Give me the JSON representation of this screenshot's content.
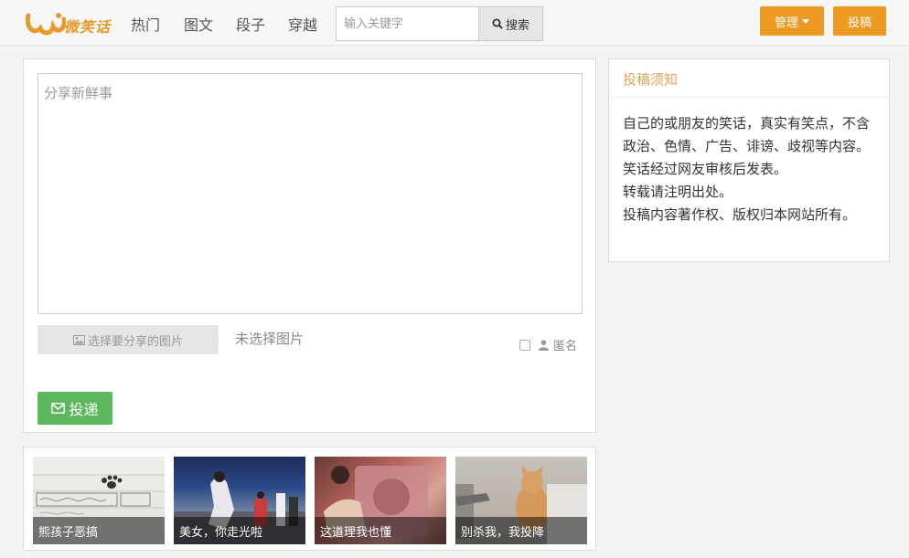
{
  "brand": {
    "name": "微笑话"
  },
  "nav": {
    "links": [
      "热门",
      "图文",
      "段子",
      "穿越"
    ],
    "search_placeholder": "输入关键字",
    "search_button": "搜索",
    "manage_button": "管理",
    "contribute_button": "投稿"
  },
  "post": {
    "placeholder": "分享新鲜事",
    "choose_image": "选择要分享的图片",
    "no_image": "未选择图片",
    "anonymous": "匿名",
    "submit": "投递"
  },
  "notice": {
    "title": "投稿须知",
    "lines": [
      "自己的或朋友的笑话，真实有笑点，不含政治、色情、广告、诽谤、歧视等内容。",
      "笑话经过网友审核后发表。",
      "转载请注明出处。",
      "投稿内容著作权、版权归本网站所有。"
    ]
  },
  "thumbnails": [
    {
      "caption": "熊孩子恶搞"
    },
    {
      "caption": "美女，你走光啦"
    },
    {
      "caption": "这道理我也懂"
    },
    {
      "caption": "别杀我，我投降"
    }
  ],
  "colors": {
    "accent_orange": "#ec9a22",
    "submit_green": "#5cb85c",
    "notice_title": "#e0a458",
    "logo": "#e89a2a"
  }
}
